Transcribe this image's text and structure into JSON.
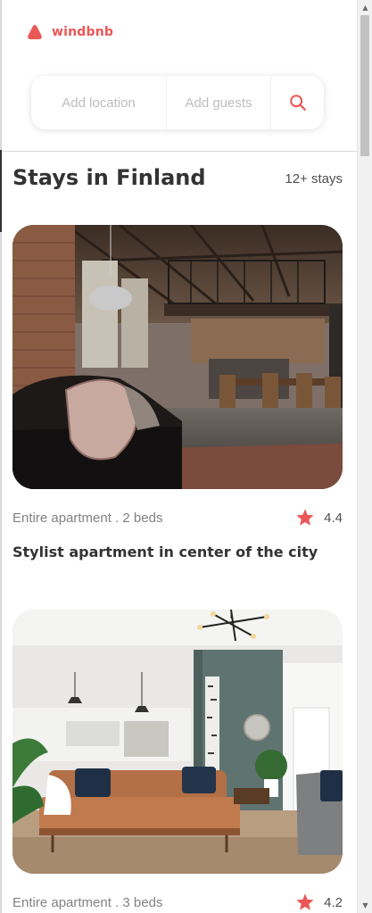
{
  "brand": {
    "name": "windbnb",
    "color": "#eb5757"
  },
  "search": {
    "location_placeholder": "Add location",
    "guests_placeholder": "Add guests",
    "icon": "search-icon"
  },
  "main": {
    "heading": "Stays in Finland",
    "count": "12+ stays"
  },
  "stays": [
    {
      "type": "Entire apartment . 2 beds",
      "rating": "4.4",
      "title": "Stylist apartment in center of the city",
      "photo": "industrial loft living room with leather sofa and mezzanine"
    },
    {
      "type": "Entire apartment . 3 beds",
      "rating": "4.2",
      "title": "",
      "photo": "bright living room with tan leather sofa and green accent wall"
    }
  ]
}
